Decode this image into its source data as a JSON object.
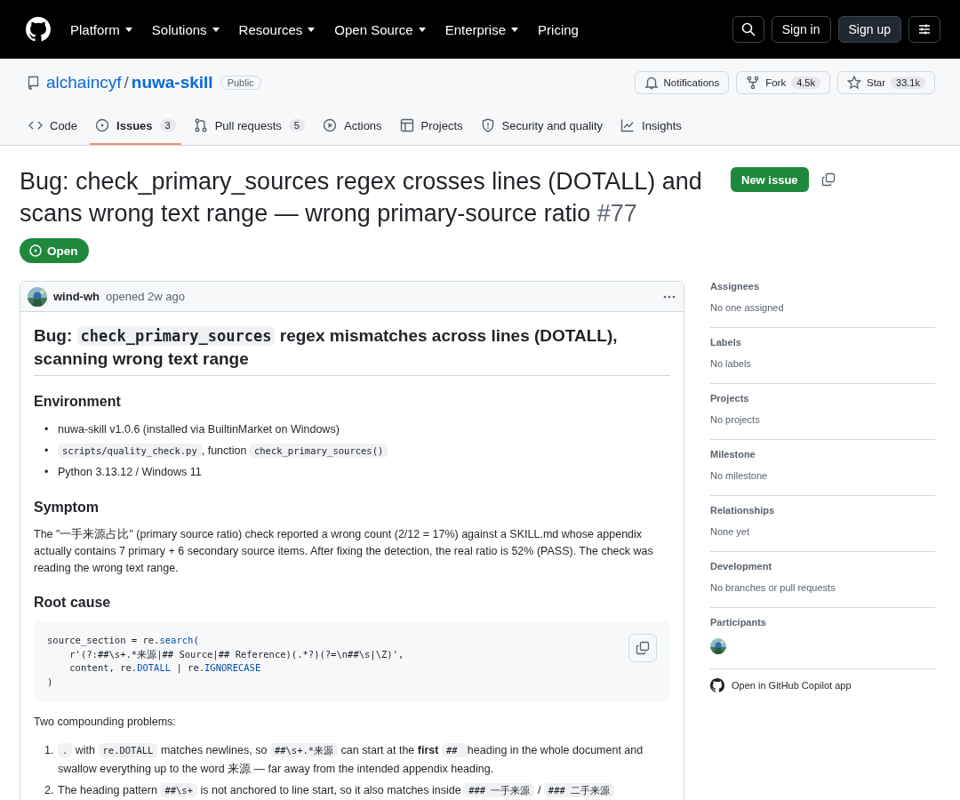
{
  "nav": {
    "items": [
      {
        "label": "Platform",
        "dropdown": true
      },
      {
        "label": "Solutions",
        "dropdown": true
      },
      {
        "label": "Resources",
        "dropdown": true
      },
      {
        "label": "Open Source",
        "dropdown": true
      },
      {
        "label": "Enterprise",
        "dropdown": true
      },
      {
        "label": "Pricing",
        "dropdown": false
      }
    ],
    "sign_in": "Sign in",
    "sign_up": "Sign up"
  },
  "repo": {
    "owner": "alchaincyf",
    "separator": "/",
    "name": "nuwa-skill",
    "visibility": "Public",
    "actions": [
      {
        "kind": "bell",
        "label": "Notifications"
      },
      {
        "kind": "fork",
        "label": "Fork",
        "count": "4.5k"
      },
      {
        "kind": "star",
        "label": "Star",
        "count": "33.1k"
      }
    ]
  },
  "tabs": [
    {
      "kind": "code",
      "label": "Code",
      "selected": false
    },
    {
      "kind": "issue",
      "label": "Issues",
      "count": "3",
      "selected": true
    },
    {
      "kind": "pr",
      "label": "Pull requests",
      "count": "5",
      "selected": false
    },
    {
      "kind": "play",
      "label": "Actions",
      "selected": false
    },
    {
      "kind": "table",
      "label": "Projects",
      "selected": false
    },
    {
      "kind": "shield",
      "label": "Security and quality",
      "selected": false
    },
    {
      "kind": "graph",
      "label": "Insights",
      "selected": false
    }
  ],
  "issue": {
    "title": "Bug: check_primary_sources regex crosses lines (DOTALL) and scans wrong text range — wrong primary-source ratio",
    "number": "#77",
    "new_issue": "New issue",
    "state": "Open"
  },
  "comment": {
    "author": "wind-wh",
    "meta": "opened 2w ago",
    "body": [
      {
        "kind": "h1",
        "parts": [
          {
            "t": "Bug: "
          },
          {
            "c": "check_primary_sources"
          },
          {
            "t": " regex mismatches across lines (DOTALL), scanning wrong text range"
          }
        ]
      },
      {
        "kind": "h2",
        "parts": [
          {
            "t": "Environment"
          }
        ]
      },
      {
        "kind": "ul",
        "items": [
          {
            "marker": "•",
            "parts": [
              {
                "t": "nuwa-skill v1.0.6 (installed via BuiltinMarket on Windows)"
              }
            ]
          },
          {
            "marker": "•",
            "parts": [
              {
                "c": "scripts/quality_check.py"
              },
              {
                "t": ", function "
              },
              {
                "c": "check_primary_sources()"
              }
            ]
          },
          {
            "marker": "•",
            "parts": [
              {
                "t": "Python 3.13.12 / Windows 11"
              }
            ]
          }
        ]
      },
      {
        "kind": "h2",
        "parts": [
          {
            "t": "Symptom"
          }
        ]
      },
      {
        "kind": "p",
        "parts": [
          {
            "t": "The \"一手来源占比\" (primary source ratio) check reported a wrong count (2/12 = 17%) against a SKILL.md whose appendix actually contains 7 primary + 6 secondary source items. After fixing the detection, the real ratio is 52% (PASS). The check was reading the wrong text range."
          }
        ]
      },
      {
        "kind": "h2",
        "parts": [
          {
            "t": "Root cause"
          }
        ]
      },
      {
        "kind": "code",
        "lines": [
          [
            {
              "t": "source_section = re."
            },
            {
              "k": "search"
            },
            {
              "t": "("
            }
          ],
          [
            {
              "t": "    r'(?:##\\s+.*来源|## Source|## Reference)(.*?)(?=\\n##\\s|\\Z)',"
            }
          ],
          [
            {
              "t": "    content, re."
            },
            {
              "k": "DOTALL"
            },
            {
              "t": " | re."
            },
            {
              "k": "IGNORECASE"
            }
          ],
          [
            {
              "t": ")"
            }
          ]
        ]
      },
      {
        "kind": "p",
        "parts": [
          {
            "t": "Two compounding problems:"
          }
        ]
      },
      {
        "kind": "ol",
        "items": [
          {
            "marker": "1.",
            "parts": [
              {
                "c": "."
              },
              {
                "t": " with "
              },
              {
                "c": "re.DOTALL"
              },
              {
                "t": " matches newlines, so "
              },
              {
                "c": "##\\s+.*来源"
              },
              {
                "t": " can start at the "
              },
              {
                "b": "first "
              },
              {
                "c": "## "
              },
              {
                "t": " heading in the whole document and swallow everything up to the word 来源 — far away from the intended appendix heading."
              }
            ]
          },
          {
            "marker": "2.",
            "parts": [
              {
                "t": "The heading pattern "
              },
              {
                "c": "##\\s+"
              },
              {
                "t": " is not anchored to line start, so it also matches inside "
              },
              {
                "c": "### 一手来源"
              },
              {
                "t": " / "
              },
              {
                "c": "### 二手来源"
              }
            ]
          }
        ]
      }
    ]
  },
  "sidebar": [
    {
      "heading": "Assignees",
      "value": "No one assigned"
    },
    {
      "heading": "Labels",
      "value": "No labels"
    },
    {
      "heading": "Projects",
      "value": "No projects"
    },
    {
      "heading": "Milestone",
      "value": "No milestone"
    },
    {
      "heading": "Relationships",
      "value": "None yet"
    },
    {
      "heading": "Development",
      "value": "No branches or pull requests"
    },
    {
      "heading": "Participants"
    }
  ],
  "copilot_link": "Open in GitHub Copilot app"
}
